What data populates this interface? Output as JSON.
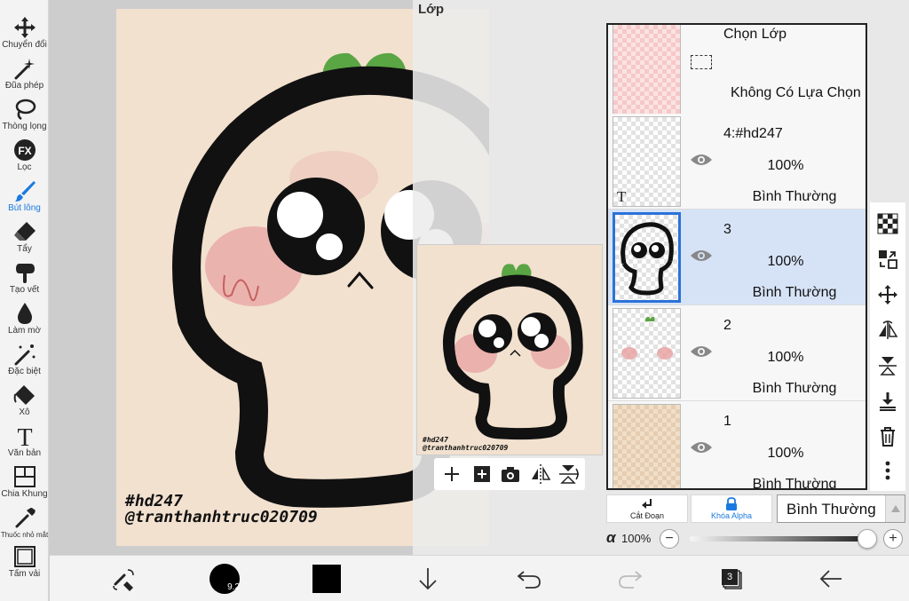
{
  "toolbar": {
    "tools": [
      {
        "label": "Chuyển đổi",
        "icon": "move-arrows-icon"
      },
      {
        "label": "Đũa phép",
        "icon": "magic-wand-icon"
      },
      {
        "label": "Thòng lọng",
        "icon": "lasso-icon"
      },
      {
        "label": "Lọc",
        "icon": "filter-fx-icon"
      },
      {
        "label": "Bút lông",
        "icon": "brush-icon",
        "active": true
      },
      {
        "label": "Tẩy",
        "icon": "eraser-icon"
      },
      {
        "label": "Tạo vết",
        "icon": "smudge-icon"
      },
      {
        "label": "Làm mờ",
        "icon": "blur-drop-icon"
      },
      {
        "label": "Đặc biệt",
        "icon": "special-brush-icon"
      },
      {
        "label": "Xô",
        "icon": "bucket-icon"
      },
      {
        "label": "Văn bản",
        "icon": "text-icon"
      },
      {
        "label": "Chia Khung",
        "icon": "frame-divider-icon"
      },
      {
        "label": "Thuốc nhỏ mắt",
        "icon": "eyedropper-icon"
      },
      {
        "label": "Tấm vải",
        "icon": "canvas-icon"
      }
    ]
  },
  "artwork": {
    "watermark_line1": "#hd247",
    "watermark_line2": "@tranthanhtruc020709"
  },
  "layer_panel": {
    "title": "Lớp",
    "selection_layer": {
      "title": "Chọn Lớp",
      "status": "Không Có Lựa Chọn"
    },
    "layers": [
      {
        "name": "4:#hd247",
        "opacity": "100%",
        "blend": "Bình Thường",
        "thumb_text": "T"
      },
      {
        "name": "3",
        "opacity": "100%",
        "blend": "Bình Thường",
        "selected": true
      },
      {
        "name": "2",
        "opacity": "100%",
        "blend": "Bình Thường"
      },
      {
        "name": "1",
        "opacity": "100%",
        "blend": "Bình Thường"
      }
    ],
    "buttons": {
      "clip": "Cắt Đoạn",
      "alpha_lock": "Khóa Alpha"
    },
    "blend_mode": "Bình Thường",
    "alpha_symbol": "α",
    "alpha_value": "100%",
    "alpha_fraction": 1.0
  },
  "bottom_bar": {
    "brush_size": "9.2",
    "layer_count": "3",
    "color": "#000000"
  },
  "colors": {
    "accent": "#1a7ae0",
    "canvas_bg": "#f2e1cf",
    "selected_row": "#d6e3f7",
    "sprout": "#5aa544",
    "blush": "#e8a0a0"
  }
}
